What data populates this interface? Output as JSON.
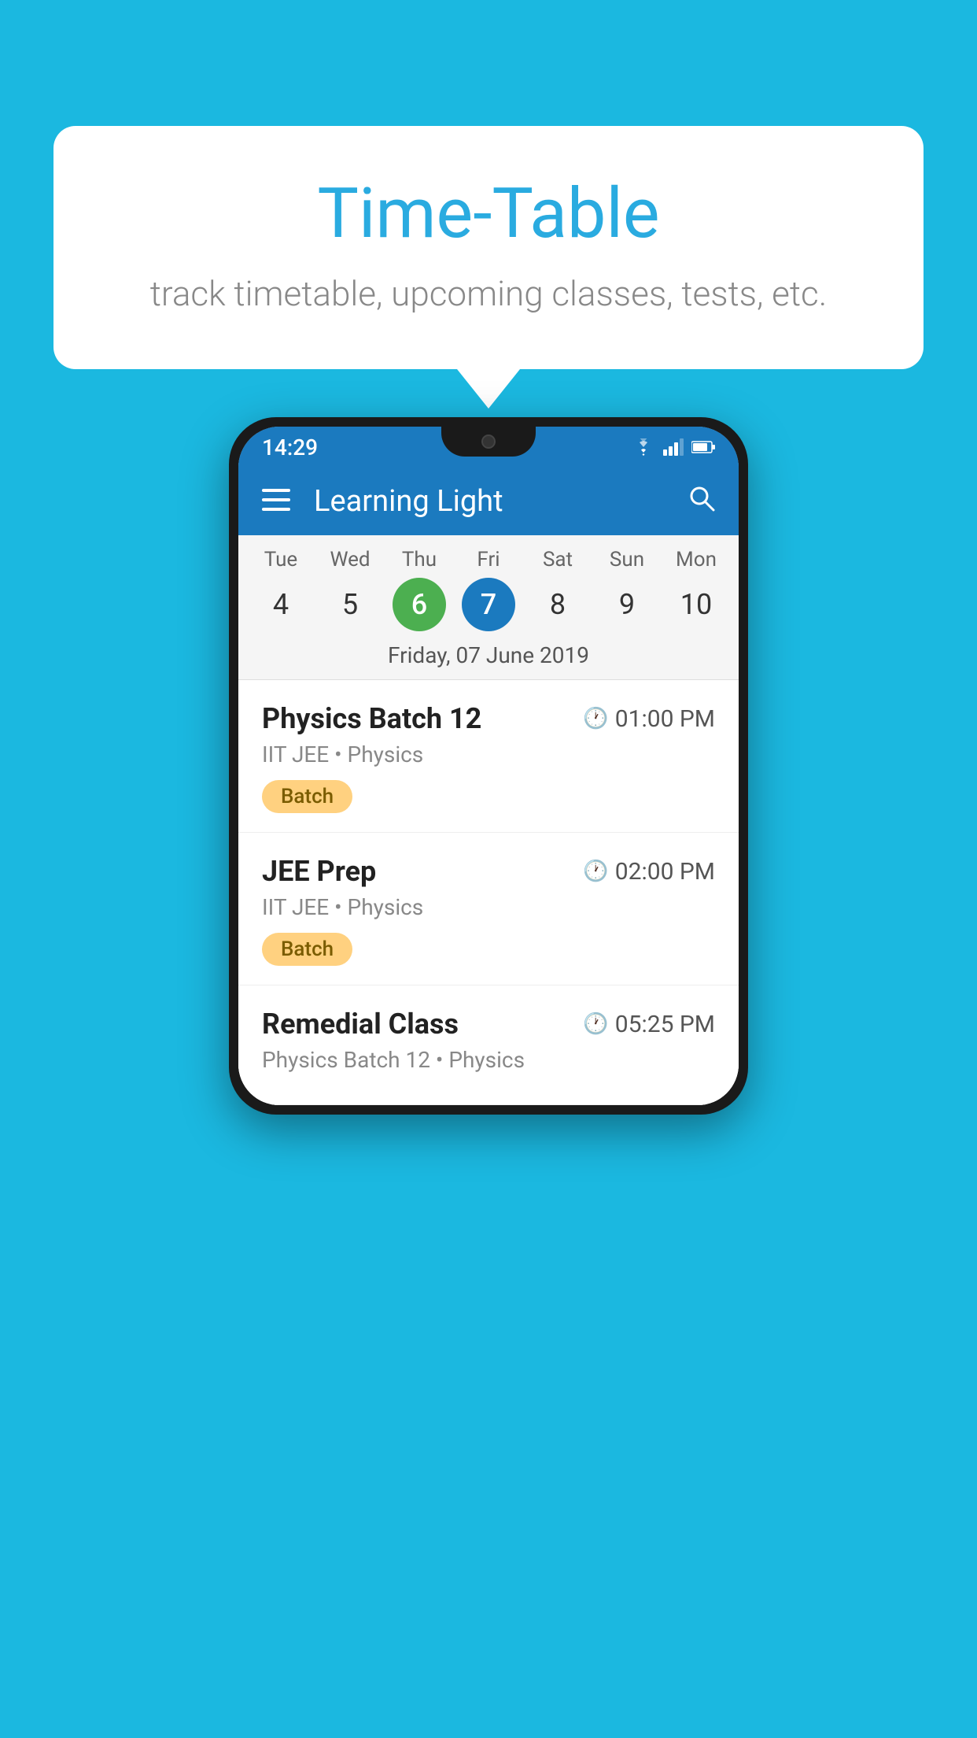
{
  "background_color": "#1bb8e0",
  "speech_bubble": {
    "title": "Time-Table",
    "subtitle": "track timetable, upcoming classes, tests, etc."
  },
  "phone": {
    "status_bar": {
      "time": "14:29"
    },
    "app_bar": {
      "title": "Learning Light"
    },
    "calendar": {
      "days": [
        {
          "name": "Tue",
          "number": "4",
          "state": "normal"
        },
        {
          "name": "Wed",
          "number": "5",
          "state": "normal"
        },
        {
          "name": "Thu",
          "number": "6",
          "state": "today"
        },
        {
          "name": "Fri",
          "number": "7",
          "state": "selected"
        },
        {
          "name": "Sat",
          "number": "8",
          "state": "normal"
        },
        {
          "name": "Sun",
          "number": "9",
          "state": "normal"
        },
        {
          "name": "Mon",
          "number": "10",
          "state": "normal"
        }
      ],
      "selected_date_label": "Friday, 07 June 2019"
    },
    "schedule_items": [
      {
        "title": "Physics Batch 12",
        "time": "01:00 PM",
        "subtitle": "IIT JEE • Physics",
        "badge": "Batch"
      },
      {
        "title": "JEE Prep",
        "time": "02:00 PM",
        "subtitle": "IIT JEE • Physics",
        "badge": "Batch"
      },
      {
        "title": "Remedial Class",
        "time": "05:25 PM",
        "subtitle": "Physics Batch 12 • Physics",
        "badge": null
      }
    ]
  }
}
